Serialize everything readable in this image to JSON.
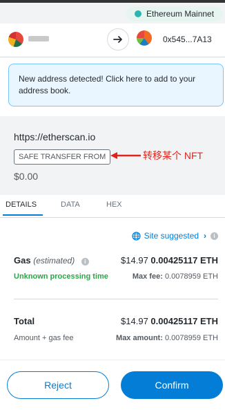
{
  "network": {
    "label": "Ethereum Mainnet",
    "dot_color": "#29b6af"
  },
  "accounts": {
    "to_address": "0x545...7A13",
    "arrow_icon": "arrow-right-icon"
  },
  "notice": {
    "text": "New address detected! Click here to add to your address book."
  },
  "origin": {
    "site": "https://etherscan.io",
    "method": "SAFE TRANSFER FROM",
    "annotation": "转移某个 NFT",
    "amount": "$0.00"
  },
  "tabs": [
    {
      "label": "DETAILS",
      "active": true
    },
    {
      "label": "DATA",
      "active": false
    },
    {
      "label": "HEX",
      "active": false
    }
  ],
  "site_suggested": {
    "label": "Site suggested",
    "icon": "globe-icon"
  },
  "gas": {
    "label": "Gas",
    "estimated": "(estimated)",
    "fiat": "$14.97",
    "eth": "0.00425117 ETH",
    "processing_time": "Unknown processing time",
    "max_fee_label": "Max fee:",
    "max_fee_value": "0.0078959 ETH"
  },
  "total": {
    "label": "Total",
    "fiat": "$14.97",
    "eth": "0.00425117 ETH",
    "sub_label": "Amount + gas fee",
    "max_amount_label": "Max amount:",
    "max_amount_value": "0.0078959 ETH"
  },
  "buttons": {
    "reject": "Reject",
    "confirm": "Confirm"
  },
  "colors": {
    "accent": "#037dd6",
    "success": "#28a745",
    "annotation": "#e2231a"
  }
}
